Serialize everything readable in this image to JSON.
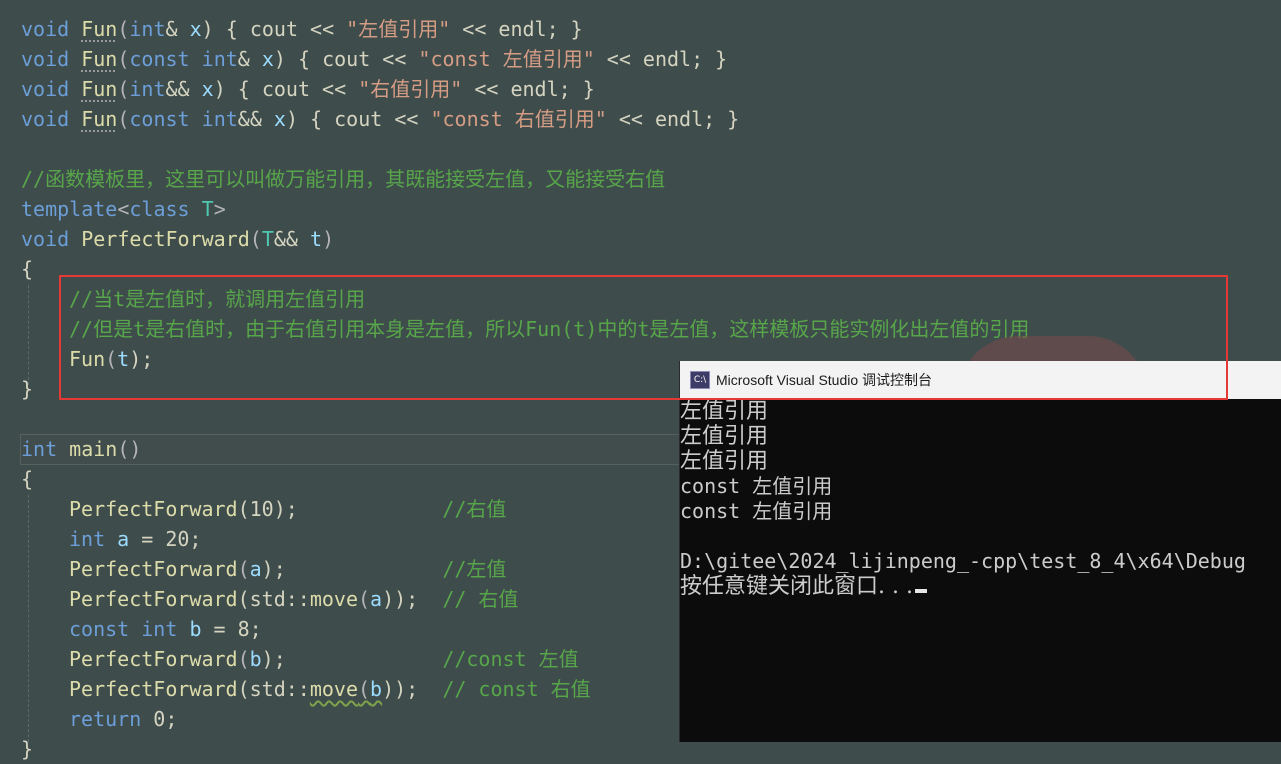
{
  "editor": {
    "lines": {
      "l1": {
        "kw": "void",
        "fn": "Fun",
        "p1": "(",
        "kw2": "int",
        "p2": "& ",
        "var": "x",
        "p3": ") { cout << ",
        "str": "\"左值引用\"",
        "p4": " << endl; }"
      },
      "l2": {
        "kw": "void",
        "fn": "Fun",
        "p1": "(",
        "kw2": "const",
        "sp": " ",
        "kw3": "int",
        "p2": "& ",
        "var": "x",
        "p3": ") { cout << ",
        "str": "\"const 左值引用\"",
        "p4": " << endl; }"
      },
      "l3": {
        "kw": "void",
        "fn": "Fun",
        "p1": "(",
        "kw2": "int",
        "p2": "&& ",
        "var": "x",
        "p3": ") { cout << ",
        "str": "\"右值引用\"",
        "p4": " << endl; }"
      },
      "l4": {
        "kw": "void",
        "fn": "Fun",
        "p1": "(",
        "kw2": "const",
        "sp": " ",
        "kw3": "int",
        "p2": "&& ",
        "var": "x",
        "p3": ") { cout << ",
        "str": "\"const 右值引用\"",
        "p4": " << endl; }"
      },
      "l6": {
        "cmt": "//函数模板里，这里可以叫做万能引用，其既能接受左值，又能接受右值"
      },
      "l7": {
        "kw": "template",
        "p1": "<",
        "kw2": "class",
        "sp": " ",
        "tp": "T",
        "p2": ">"
      },
      "l8": {
        "kw": "void",
        "sp": " ",
        "fn": "PerfectForward",
        "p1": "(",
        "tp": "T",
        "p2": "&& ",
        "var": "t",
        "p3": ")"
      },
      "l9": {
        "p": "{"
      },
      "l10": {
        "cmt": "//当t是左值时，就调用左值引用"
      },
      "l11": {
        "cmt": "//但是t是右值时，由于右值引用本身是左值，所以Fun(t)中的t是左值，这样模板只能实例化出左值的引用"
      },
      "l12": {
        "fn": "Fun",
        "p1": "(",
        "var": "t",
        "p2": ");"
      },
      "l13": {
        "p": "}"
      },
      "l15": {
        "kw": "int",
        "sp": " ",
        "fn": "main",
        "p1": "()"
      },
      "l16": {
        "p": "{"
      },
      "l17": {
        "fn": "PerfectForward",
        "p1": "(10);",
        "pad": "            ",
        "cmt": "//右值"
      },
      "l18": {
        "kw": "int",
        "sp": " ",
        "var": "a",
        "p1": " = 20;"
      },
      "l19": {
        "fn": "PerfectForward",
        "p1": "(",
        "var": "a",
        "p2": ");",
        "pad": "             ",
        "cmt": "//左值"
      },
      "l20": {
        "fn": "PerfectForward",
        "p1": "(std::",
        "fn2": "move",
        "p2": "(",
        "var": "a",
        "p3": "));",
        "pad": "  ",
        "cmt": "// 右值"
      },
      "l21": {
        "kw": "const",
        "sp": " ",
        "kw2": "int",
        "sp2": " ",
        "var": "b",
        "p1": " = 8;"
      },
      "l22": {
        "fn": "PerfectForward",
        "p1": "(",
        "var": "b",
        "p2": ");",
        "pad": "             ",
        "cmt": "//const 左值"
      },
      "l23": {
        "fn": "PerfectForward",
        "p1": "(std::",
        "fn2": "move",
        "p2": "(",
        "var": "b",
        "p3": "));",
        "pad": "  ",
        "cmt": "// const 右值"
      },
      "l24": {
        "kw": "return",
        "p1": " 0;"
      },
      "l25": {
        "p": "}"
      }
    }
  },
  "console": {
    "title": "Microsoft Visual Studio 调试控制台",
    "icon_text": "C:\\",
    "output": [
      "左值引用",
      "左值引用",
      "左值引用",
      "const 左值引用",
      "const 左值引用",
      "",
      "D:\\gitee\\2024_lijinpeng_-cpp\\test_8_4\\x64\\Debug",
      "按任意键关闭此窗口. . ."
    ]
  },
  "colors": {
    "editor_bg": "#3f4c4c",
    "keyword": "#6c9ed8",
    "function": "#dcdcaa",
    "string": "#d69d85",
    "comment": "#57a64a",
    "highlight_border": "#e53935",
    "console_bg": "#0c0c0c"
  }
}
